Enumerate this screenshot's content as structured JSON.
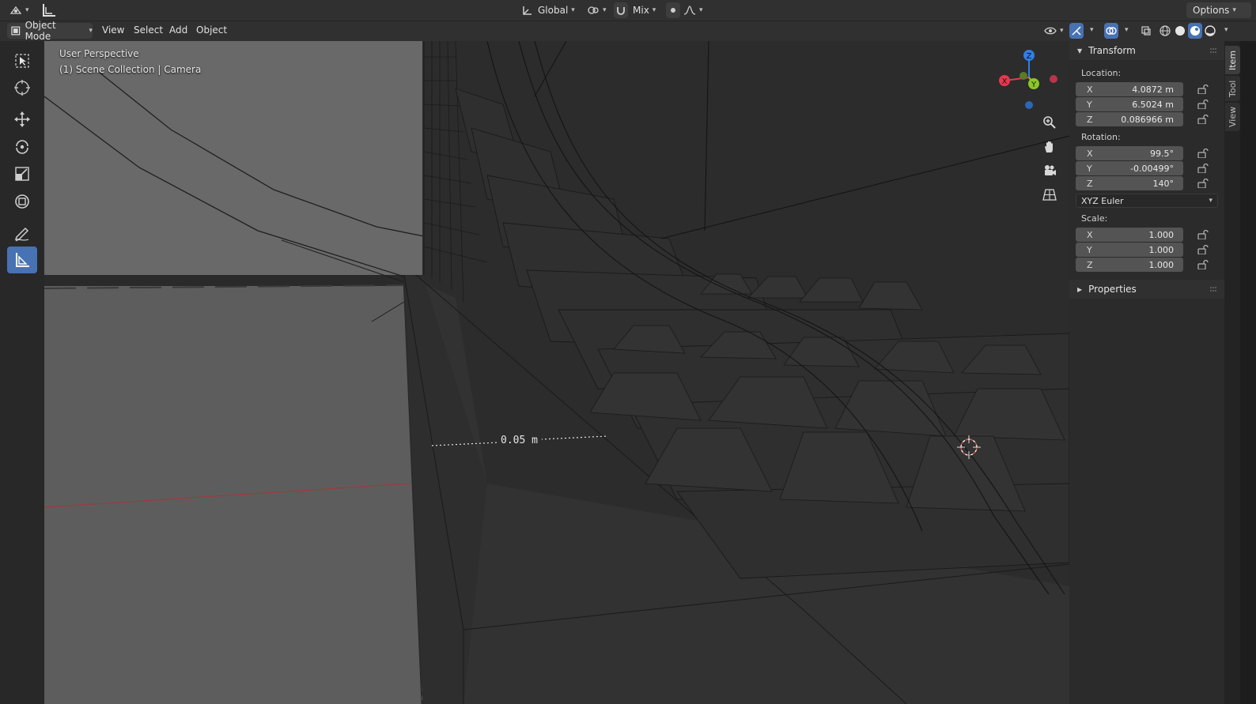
{
  "header": {
    "orientation": "Global",
    "snap_mode": "Mix",
    "options_label": "Options"
  },
  "menubar": {
    "mode": "Object Mode",
    "items": [
      "View",
      "Select",
      "Add",
      "Object"
    ]
  },
  "viewport": {
    "view_name": "User Perspective",
    "context": "(1) Scene Collection | Camera",
    "measure_value": "0.05 m",
    "gizmo": {
      "x": "X",
      "y": "Y",
      "z": "Z"
    }
  },
  "sidebar": {
    "transform_title": "Transform",
    "location_label": "Location:",
    "location": [
      {
        "axis": "X",
        "value": "4.0872 m"
      },
      {
        "axis": "Y",
        "value": "6.5024 m"
      },
      {
        "axis": "Z",
        "value": "0.086966 m"
      }
    ],
    "rotation_label": "Rotation:",
    "rotation": [
      {
        "axis": "X",
        "value": "99.5°"
      },
      {
        "axis": "Y",
        "value": "-0.00499°"
      },
      {
        "axis": "Z",
        "value": "140°"
      }
    ],
    "rotation_mode": "XYZ Euler",
    "scale_label": "Scale:",
    "scale": [
      {
        "axis": "X",
        "value": "1.000"
      },
      {
        "axis": "Y",
        "value": "1.000"
      },
      {
        "axis": "Z",
        "value": "1.000"
      }
    ],
    "properties_title": "Properties"
  },
  "tabs": [
    "Item",
    "Tool",
    "View"
  ],
  "colors": {
    "accent": "#4772b3",
    "axis_x": "#e8384f",
    "axis_y": "#8ac926",
    "axis_z": "#2f7fe8"
  }
}
